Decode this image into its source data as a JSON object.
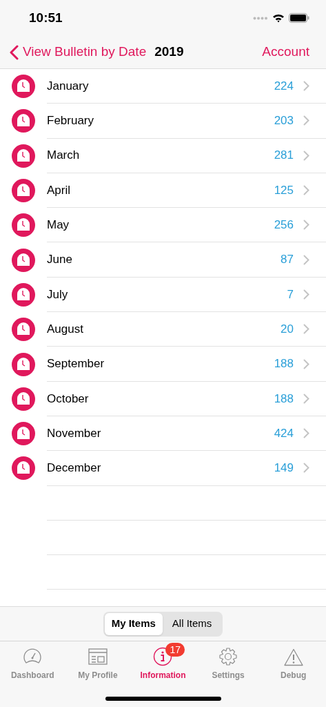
{
  "status_bar": {
    "time": "10:51"
  },
  "nav": {
    "back_label": "View Bulletin by Date",
    "title": "2019",
    "action": "Account"
  },
  "months": [
    {
      "name": "January",
      "count": "224"
    },
    {
      "name": "February",
      "count": "203"
    },
    {
      "name": "March",
      "count": "281"
    },
    {
      "name": "April",
      "count": "125"
    },
    {
      "name": "May",
      "count": "256"
    },
    {
      "name": "June",
      "count": "87"
    },
    {
      "name": "July",
      "count": "7"
    },
    {
      "name": "August",
      "count": "20"
    },
    {
      "name": "September",
      "count": "188"
    },
    {
      "name": "October",
      "count": "188"
    },
    {
      "name": "November",
      "count": "424"
    },
    {
      "name": "December",
      "count": "149"
    }
  ],
  "segments": [
    {
      "label": "My Items",
      "selected": true
    },
    {
      "label": "All Items",
      "selected": false
    }
  ],
  "tabs": [
    {
      "kind": "dashboard",
      "label": "Dashboard",
      "selected": false
    },
    {
      "kind": "profile",
      "label": "My Profile",
      "selected": false
    },
    {
      "kind": "info",
      "label": "Information",
      "selected": true,
      "badge": "17"
    },
    {
      "kind": "settings",
      "label": "Settings",
      "selected": false
    },
    {
      "kind": "debug",
      "label": "Debug",
      "selected": false
    }
  ]
}
